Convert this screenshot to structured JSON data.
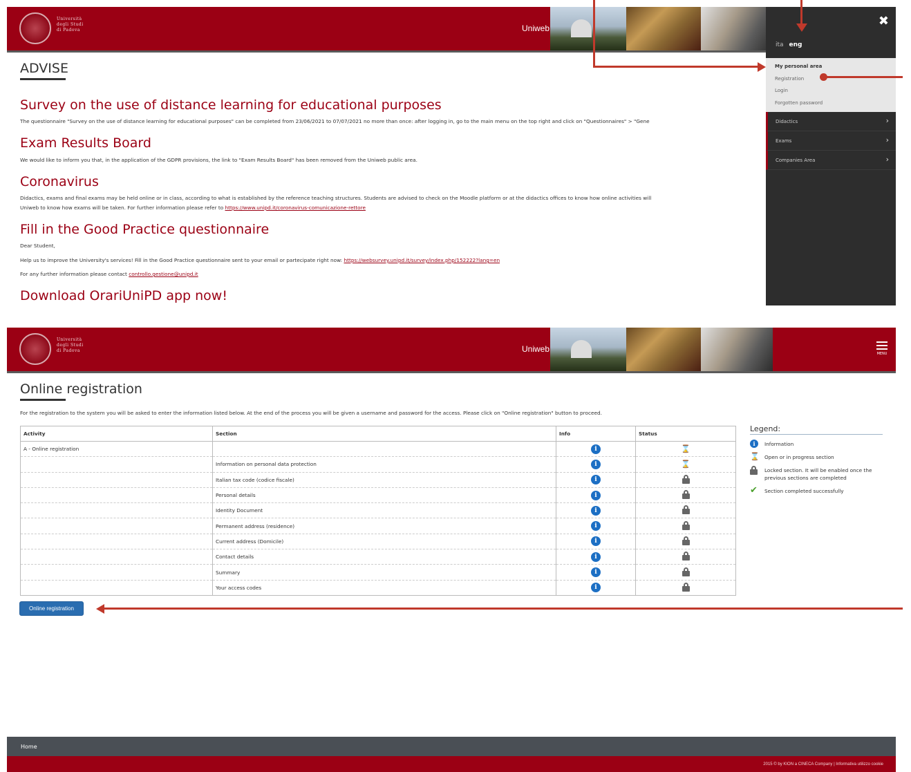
{
  "header": {
    "logo_text": [
      "Università",
      "degli Studi",
      "di Padova"
    ],
    "brand": "Uniweb"
  },
  "menu_panel": {
    "close_glyph": "✖",
    "lang_ita": "ita",
    "lang_eng": "eng",
    "personal_title": "My personal area",
    "personal_items": [
      "Registration",
      "Login",
      "Forgotten password"
    ],
    "menu_items": [
      "Didactics",
      "Exams",
      "Companies Area"
    ]
  },
  "advise": {
    "title": "ADVISE",
    "news": [
      {
        "title": "Survey on the use of distance learning for educational purposes",
        "text": "The questionnaire \"Survey on the use of distance learning for educational purposes\" can be completed from 23/06/2021 to 07/07/2021 no more than once: after logging in, go to the main menu on the top right and click on \"Questionnaires\" > \"Gene"
      },
      {
        "title": "Exam Results Board",
        "text": "We would like to inform you that, in the application of the GDPR provisions, the link to \"Exam Results Board\" has been removed from the Uniweb public area."
      },
      {
        "title": "Coronavirus",
        "text": "Didactics, exams and final exams may be held online or in class, according to what is established by the reference teaching structures. Students are advised to check on the Moodle platform or at the didactics offices to know how online activities will",
        "text2": "Uniweb to know how exams will be taken. For further information please refer to",
        "link": "https://www.unipd.it/coronavirus-comunicazione-rettore"
      },
      {
        "title": "Fill in the Good Practice questionnaire",
        "line1": "Dear Student,",
        "line2": "Help us to improve the University's services! Fill in the Good Practice questionnaire sent to your email or partecipate right now:",
        "link2": "https://websurvey.unipd.it/survey/index.php/152222?lang=en",
        "line3": "For any further information please contact",
        "link3": "controllo.gestione@unipd.it"
      },
      {
        "title": "Download OrariUniPD app now!"
      }
    ]
  },
  "registration": {
    "menu_label": "MENU",
    "title": "Online registration",
    "description": "For the registration to the system you will be asked to enter the information listed below. At the end of the process you will be given a username and password for the access. Please click on \"Online registration\" button to proceed.",
    "columns": [
      "Activity",
      "Section",
      "Info",
      "Status"
    ],
    "rows": [
      {
        "activity": "A - Online registration",
        "section": "",
        "status": "open"
      },
      {
        "activity": "",
        "section": "Information on personal data protection",
        "status": "open"
      },
      {
        "activity": "",
        "section": "Italian tax code (codice fiscale)",
        "status": "locked"
      },
      {
        "activity": "",
        "section": "Personal details",
        "status": "locked"
      },
      {
        "activity": "",
        "section": "Identity Document",
        "status": "locked"
      },
      {
        "activity": "",
        "section": "Permanent address (residence)",
        "status": "locked"
      },
      {
        "activity": "",
        "section": "Current address (Domicile)",
        "status": "locked"
      },
      {
        "activity": "",
        "section": "Contact details",
        "status": "locked"
      },
      {
        "activity": "",
        "section": "Summary",
        "status": "locked"
      },
      {
        "activity": "",
        "section": "Your access codes",
        "status": "locked"
      }
    ],
    "legend_title": "Legend:",
    "legend": [
      {
        "icon": "info-icon",
        "text": "Information"
      },
      {
        "icon": "hourglass-icon",
        "text": "Open or in progress section"
      },
      {
        "icon": "lock-icon",
        "text": "Locked section. It will be enabled once the previous sections are completed"
      },
      {
        "icon": "check-icon",
        "text": "Section completed successfully"
      }
    ],
    "button": "Online registration"
  },
  "footer": {
    "home": "Home",
    "copyright": "2015 © by KION a CINECA Company | Informativa utilizzo cookie"
  },
  "colors": {
    "brand_red": "#9b0014",
    "arrow": "#c0392b",
    "button_blue": "#2a6db0"
  }
}
